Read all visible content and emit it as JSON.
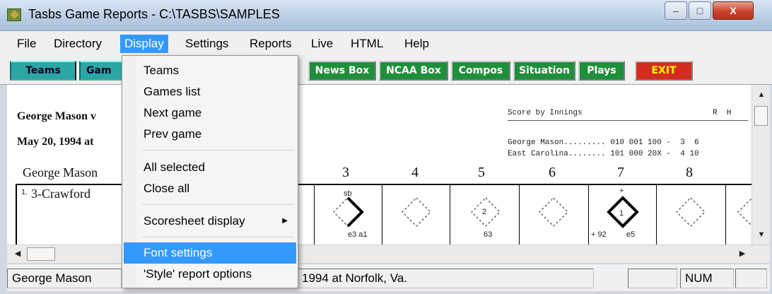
{
  "window": {
    "title": "Tasbs Game Reports - C:\\TASBS\\SAMPLES",
    "minimize_glyph": "–",
    "maximize_glyph": "□",
    "close_glyph": "X"
  },
  "menubar": {
    "items": [
      "File",
      "Directory",
      "Display",
      "Settings",
      "Reports",
      "Live",
      "HTML",
      "Help"
    ]
  },
  "toolbar": {
    "teams": "Teams",
    "games_partial": "Gam",
    "news_box": "News Box",
    "ncaa_box": "NCAA Box",
    "compos": "Compos",
    "situation": "Situation",
    "plays": "Plays",
    "exit": "EXIT"
  },
  "report": {
    "heading_1": "George Mason v",
    "heading_2": "May 20, 1994 at",
    "team_label": "George Mason",
    "batter": "3-Crawford",
    "batter_num": "1.",
    "score_by_innings": "Score by Innings",
    "rh_header": "R  H",
    "line_1": "George Mason......... 010 001 100 -  3  6",
    "line_2": "East Carolina........ 101 000 20X -  4 10",
    "innings": [
      "3",
      "4",
      "5",
      "6",
      "7",
      "8"
    ],
    "notes": {
      "sb": "sb",
      "e3a1": "e3 a1",
      "two": "2",
      "sixtythree": "63",
      "plus": "+",
      "one": "1",
      "plus92": "+ 92",
      "e5": "e5"
    }
  },
  "dropdown": {
    "items": [
      {
        "label": "Teams"
      },
      {
        "label": "Games list"
      },
      {
        "label": "Next game"
      },
      {
        "label": "Prev game"
      },
      {
        "label": "All selected"
      },
      {
        "label": "Close all"
      },
      {
        "label": "Scoresheet display"
      },
      {
        "label": "Font settings"
      },
      {
        "label": "'Style' report options"
      }
    ],
    "submenu_arrow": "▶"
  },
  "statusbar": {
    "left": "George Mason",
    "middle": "1994 at Norfolk, Va.",
    "num": "NUM"
  },
  "colors": {
    "highlight": "#3399ff",
    "teal_button": "#2ba6a6",
    "green_button": "#1e8f3a",
    "exit_button": "#d42d1f"
  }
}
